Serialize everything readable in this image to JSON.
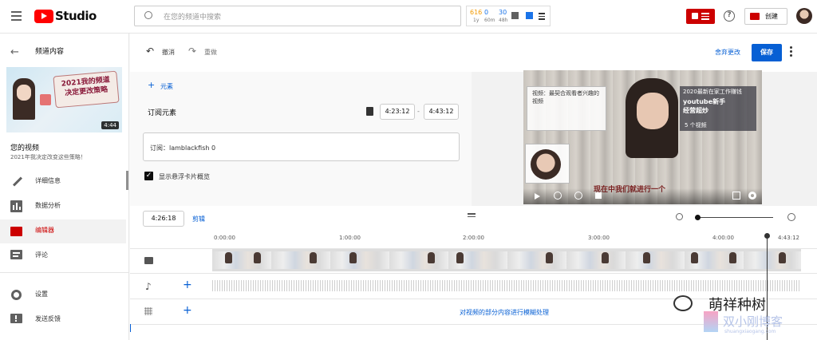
{
  "header": {
    "logo_text": "Studio",
    "search_placeholder": "在您的频道中搜索",
    "stats": {
      "val1": "616",
      "val2": "0",
      "val3": "30",
      "sub1": "1y",
      "sub2": "60m",
      "sub3": "48h"
    },
    "create_label": "创建"
  },
  "sidebar": {
    "back_title": "频道内容",
    "thumbnail_title": "2021我的频道 决定更改策略",
    "duration": "4:44",
    "video_label": "您的视频",
    "video_title": "2021年我决定改变这些策略！",
    "items": [
      {
        "label": "详细信息",
        "icon": "pencil-icon"
      },
      {
        "label": "数据分析",
        "icon": "analytics-icon"
      },
      {
        "label": "编辑器",
        "icon": "editor-icon"
      },
      {
        "label": "评论",
        "icon": "comments-icon"
      },
      {
        "label": "设置",
        "icon": "gear-icon"
      },
      {
        "label": "发送反馈",
        "icon": "feedback-icon"
      }
    ]
  },
  "toolbar": {
    "undo_label": "撤消",
    "redo_label": "重做",
    "discard_label": "舍弃更改",
    "save_label": "保存"
  },
  "editor": {
    "add_element_label": "元素",
    "element_name": "订阅元素",
    "start_time": "4:23:12",
    "end_time": "4:43:12",
    "dash": "-",
    "subscribe_text": "订阅：lamblackfish 0",
    "checkbox_label": "显示悬浮卡片概览",
    "checkbox_checked": true
  },
  "preview": {
    "card_left_text": "视频：最契合观看者兴趣的视频",
    "card_right_title": "2020最新在家工作赚钱",
    "card_right_sub1": "youtube新手",
    "card_right_sub2": "经营超炒",
    "playlist_label": "5 个视频",
    "subtitle": "现在中我们就进行一个"
  },
  "timeline": {
    "current_time": "4:26:18",
    "trim_label": "剪辑",
    "ticks": [
      "0:00:00",
      "1:00:00",
      "2:00:00",
      "3:00:00",
      "4:00:00",
      "4:43:12"
    ],
    "blur_label": "对视频的部分内容进行模糊处理"
  },
  "watermark": {
    "title": "萌祥种树",
    "site": "双小刚博客",
    "site_url": "shuangxiaogang.com"
  },
  "colors": {
    "accent": "#065fd4",
    "brand_red": "#ff0000",
    "active_red": "#cc0000"
  }
}
